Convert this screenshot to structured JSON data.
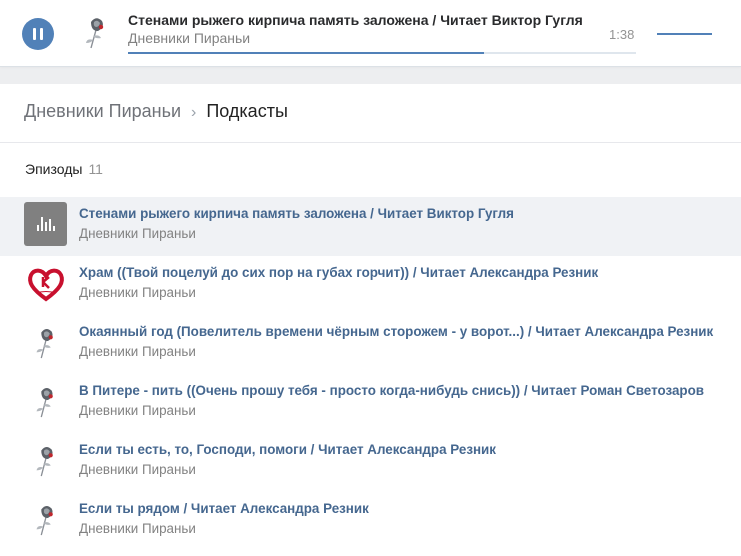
{
  "player": {
    "title": "Стенами рыжего кирпича память заложена / Читает Виктор Гугля",
    "artist": "Дневники Пираньи",
    "time": "1:38",
    "progress": 0.7,
    "volume": 1.0,
    "state": "playing"
  },
  "breadcrumb": {
    "parent": "Дневники Пираньи",
    "current": "Подкасты"
  },
  "episodes": {
    "label": "Эпизоды",
    "count": "11",
    "items": [
      {
        "title": "Стенами рыжего кирпича память заложена / Читает Виктор Гугля",
        "artist": "Дневники Пираньи",
        "cover": "equalizer-icon",
        "active": true
      },
      {
        "title": "Храм ((Твой поцелуй до сих пор на губах горчит)) / Читает Александра Резник",
        "artist": "Дневники Пираньи",
        "cover": "heart-logo",
        "active": false
      },
      {
        "title": "Окаянный год (Повелитель времени чёрным сторожем - у ворот...) / Читает Александра Резник",
        "artist": "Дневники Пираньи",
        "cover": "rose-icon",
        "active": false
      },
      {
        "title": "В Питере - пить ((Очень прошу тебя - просто когда-нибудь снись)) / Читает Роман Светозаров",
        "artist": "Дневники Пираньи",
        "cover": "rose-icon",
        "active": false
      },
      {
        "title": "Если ты есть, то, Господи, помоги / Читает Александра Резник",
        "artist": "Дневники Пираньи",
        "cover": "rose-icon",
        "active": false
      },
      {
        "title": "Если ты рядом / Читает Александра Резник",
        "artist": "Дневники Пираньи",
        "cover": "rose-icon",
        "active": false
      }
    ]
  },
  "colors": {
    "accent": "#5181b8",
    "link": "#45678f",
    "muted": "#828282",
    "logo_red": "#c8102e"
  }
}
